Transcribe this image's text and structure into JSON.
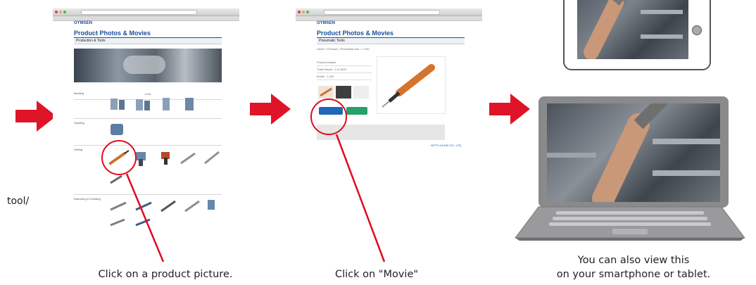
{
  "captions": {
    "step1": "Click on a product picture.",
    "step2": "Click on \"Movie\"",
    "step3_line1": "You can also view this",
    "step3_line2": "on your smartphone or tablet."
  },
  "left_fragment": "tool/",
  "screenshot1": {
    "logo": "OYMSEN",
    "title": "Product Photos & Movies",
    "subtitle": "Production & Tools",
    "center_label": "J-001",
    "categories": [
      {
        "label": "Molding"
      },
      {
        "label": "Sanding"
      },
      {
        "label": "Drilling"
      },
      {
        "label": "Deburring & Grinding"
      }
    ]
  },
  "screenshot2": {
    "logo": "OYMSEN",
    "title": "Product Photos & Movies",
    "subtitle": "Pneumatic Tools",
    "breadcrumb": "Home > Product > Pneumatic tool > J-100",
    "fields": [
      "Product Details",
      "Trade Name : J-A-100S",
      "Model : J-100"
    ],
    "footer": "NITTO KOHKI CO., LTD."
  },
  "colors": {
    "accent_red": "#e01428",
    "circle_red": "#e00b21",
    "brand_blue": "#1a4f9a",
    "laptop_body": "#8a8a8c"
  },
  "icons": [
    "red-arrow-icon",
    "home-button-icon",
    "keyboard-icon"
  ]
}
